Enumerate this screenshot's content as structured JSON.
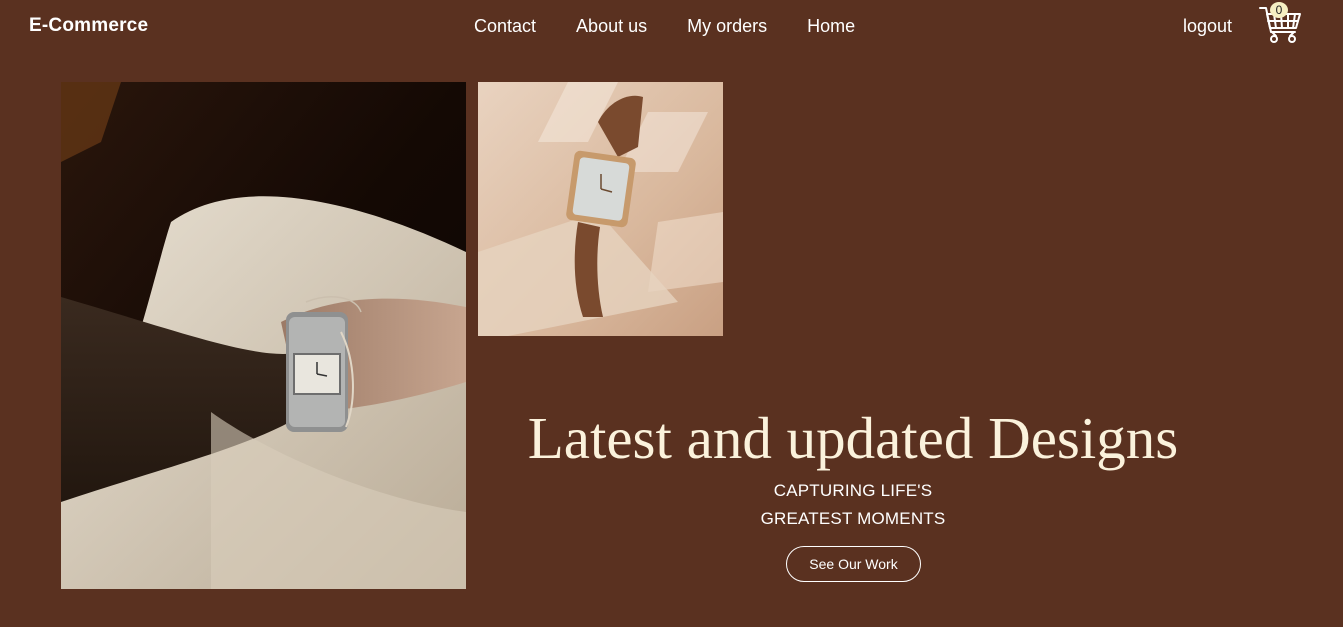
{
  "navbar": {
    "brand": "E-Commerce",
    "links": [
      "Contact",
      "About us",
      "My orders",
      "Home"
    ],
    "logout": "logout",
    "cart_count": "0"
  },
  "images": {
    "large_photo": "wristwatch-on-wrist-photo",
    "small_photo": "gold-square-watch-photo"
  },
  "hero": {
    "title": "Latest and updated Designs",
    "subtitle_line1": "CAPTURING LIFE'S",
    "subtitle_line2": "GREATEST MOMENTS",
    "cta_label": "See Our Work"
  },
  "colors": {
    "background": "#5a3120",
    "title": "#fbf2dc",
    "badge": "#f6efc2"
  }
}
